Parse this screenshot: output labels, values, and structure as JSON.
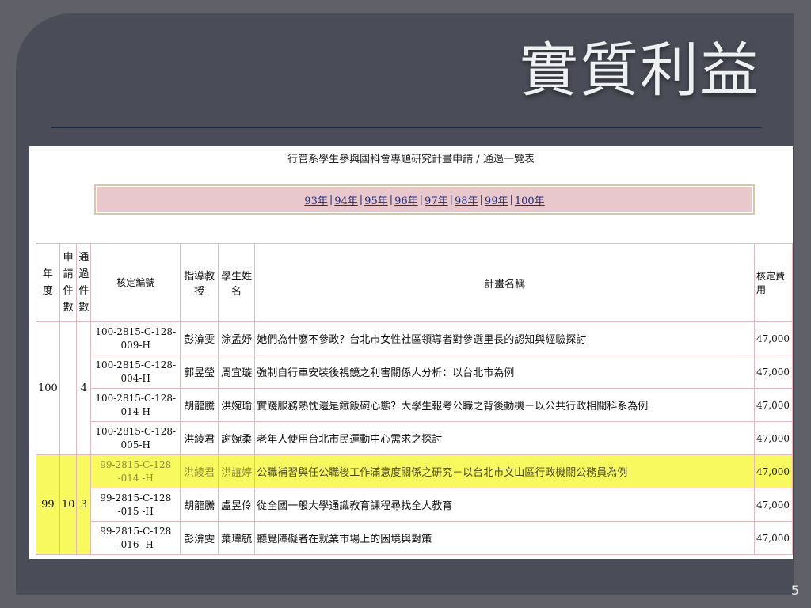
{
  "slide": {
    "title": "實質利益",
    "page_number": "5"
  },
  "screenshot": {
    "header": "行管系學生參與國科會專題研究計畫申請 / 通過一覽表",
    "years": [
      "93年",
      "94年",
      "95年",
      "96年",
      "97年",
      "98年",
      "99年",
      "100年"
    ],
    "separator": "|",
    "columns": {
      "year": "年度",
      "apply_count": "申請件數",
      "pass_count": "通過件數",
      "code": "核定編號",
      "advisor": "指導教授",
      "student": "學生姓名",
      "title": "計畫名稱",
      "fee": "核定費用"
    },
    "groups": [
      {
        "year": "100",
        "apply_count": "",
        "pass_count": "4",
        "rows": [
          {
            "code": "100-2815-C-128-009-H",
            "advisor": "彭渰雯",
            "student": "涂孟妤",
            "title": "她們為什麼不參政？台北市女性社區領導者對參選里長的認知與經驗探討",
            "fee": "47,000"
          },
          {
            "code": "100-2815-C-128-004-H",
            "advisor": "郭昱瑩",
            "student": "周宜璇",
            "title": "強制自行車安裝後視鏡之利害關係人分析：以台北市為例",
            "fee": "47,000"
          },
          {
            "code": "100-2815-C-128-014-H",
            "advisor": "胡龍騰",
            "student": "洪婉瑜",
            "title": "實踐服務熱忱還是鐵飯碗心態？大學生報考公職之背後動機－以公共行政相關科系為例",
            "fee": "47,000"
          },
          {
            "code": "100-2815-C-128-005-H",
            "advisor": "洪綾君",
            "student": "謝婉柔",
            "title": "老年人使用台北市民運動中心需求之探討",
            "fee": "47,000"
          }
        ]
      },
      {
        "year": "99",
        "apply_count": "10",
        "pass_count": "3",
        "rows": [
          {
            "code": "99-2815-C-128 -014 -H",
            "advisor": "洪綾君",
            "student": "洪誼婷",
            "title": "公職補習與任公職後工作滿意度關係之研究－以台北市文山區行政機關公務員為例",
            "fee": "47,000",
            "highlighted": true
          },
          {
            "code": "99-2815-C-128 -015 -H",
            "advisor": "胡龍騰",
            "student": "盧昱伶",
            "title": "從全國一般大學通識教育課程尋找全人教育",
            "fee": "47,000"
          },
          {
            "code": "99-2815-C-128 -016 -H",
            "advisor": "彭渰雯",
            "student": "葉瑋毓",
            "title": "聽覺障礙者在就業市場上的困境與對策",
            "fee": "47,000"
          }
        ]
      }
    ]
  }
}
